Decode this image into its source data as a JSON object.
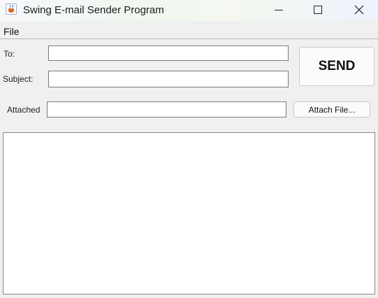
{
  "window": {
    "title": "Swing E-mail Sender Program"
  },
  "menu": {
    "file": "File"
  },
  "form": {
    "to_label": "To:",
    "to_value": "",
    "subject_label": "Subject:",
    "subject_value": "",
    "attached_label": "Attached",
    "attached_value": "",
    "body_value": ""
  },
  "buttons": {
    "send": "SEND",
    "attach": "Attach File..."
  },
  "icons": {
    "app": "java-coffee-cup-icon",
    "minimize": "minimize-icon",
    "maximize": "maximize-icon",
    "close": "close-icon"
  }
}
